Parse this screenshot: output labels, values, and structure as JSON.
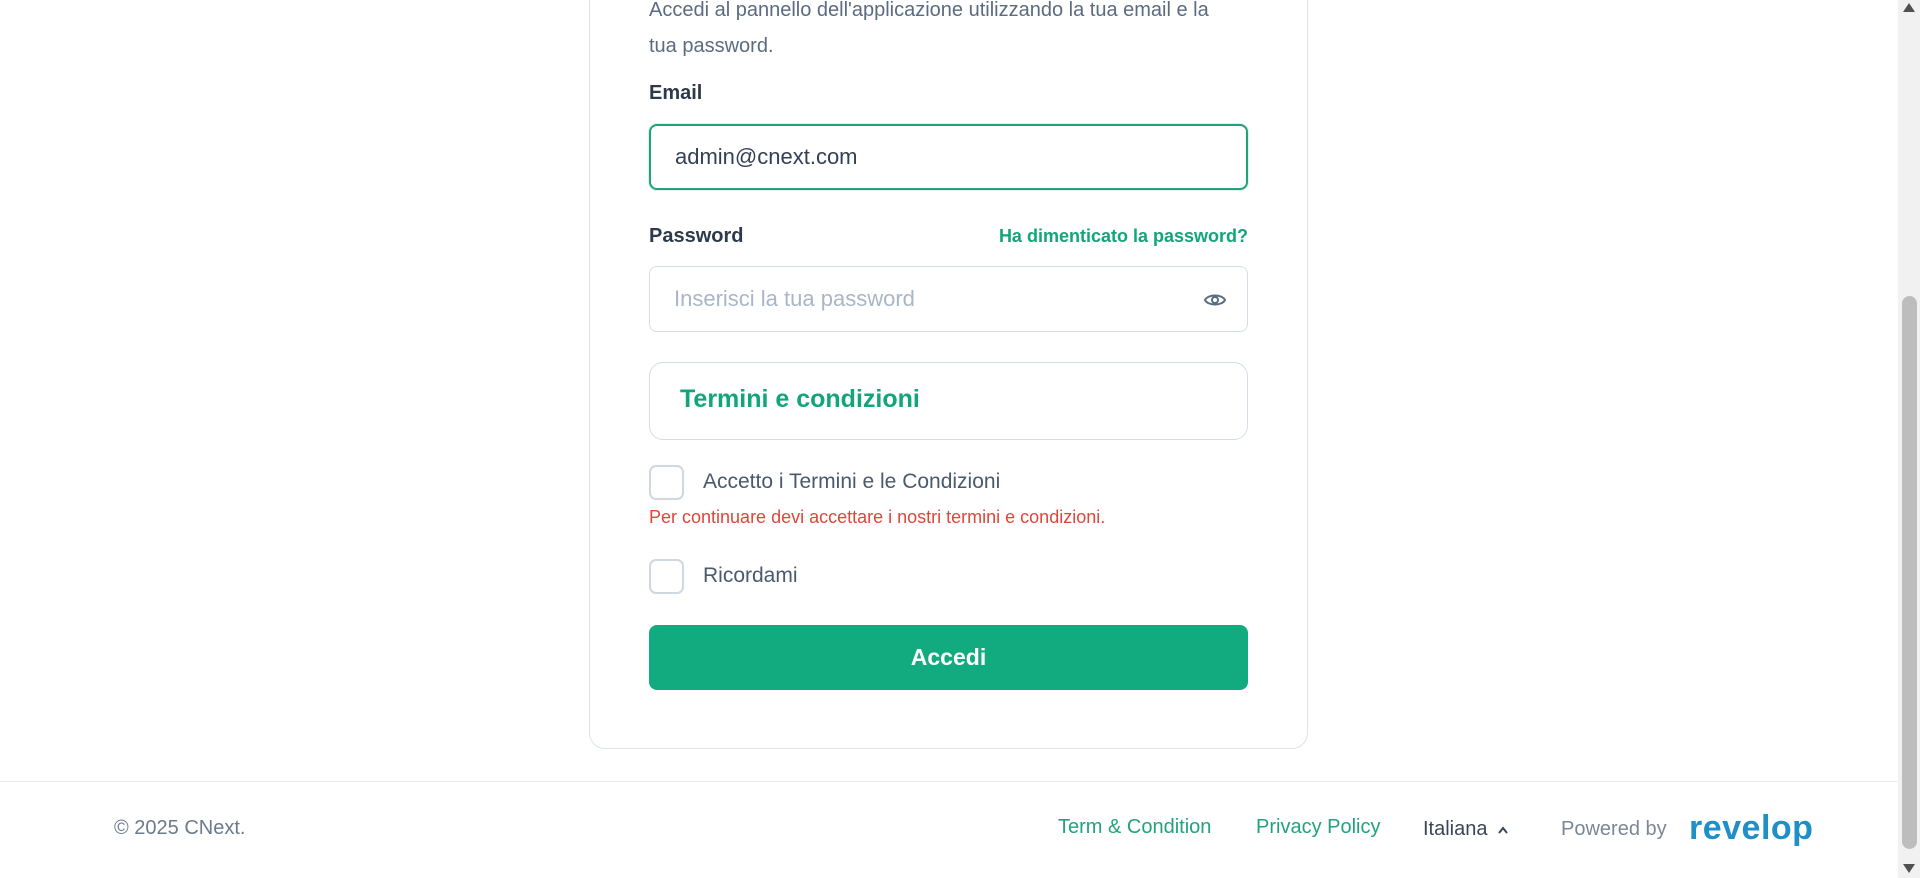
{
  "intro": {
    "text_line1": "Accedi al pannello dell'applicazione utilizzando la tua email e la",
    "text_line2": "tua password."
  },
  "email": {
    "label": "Email",
    "value": "admin@cnext.com"
  },
  "password": {
    "label": "Password",
    "forgot_link": "Ha dimenticato la password?",
    "placeholder": "Inserisci la tua password",
    "toggle_icon": "eye-icon"
  },
  "terms": {
    "title": "Termini e condizioni",
    "accept_label": "Accetto i Termini e le Condizioni",
    "error": "Per continuare devi accettare i nostri termini e condizioni."
  },
  "remember": {
    "label": "Ricordami"
  },
  "submit": {
    "label": "Accedi"
  },
  "footer": {
    "copyright": "© 2025 CNext.",
    "terms_link": "Term & Condition",
    "privacy_link": "Privacy Policy",
    "language": "Italiana",
    "powered_by": "Powered by",
    "brand": "revelop"
  },
  "colors": {
    "accent": "#12ab80",
    "error": "#e0453a",
    "brand": "#1f8fc8"
  }
}
